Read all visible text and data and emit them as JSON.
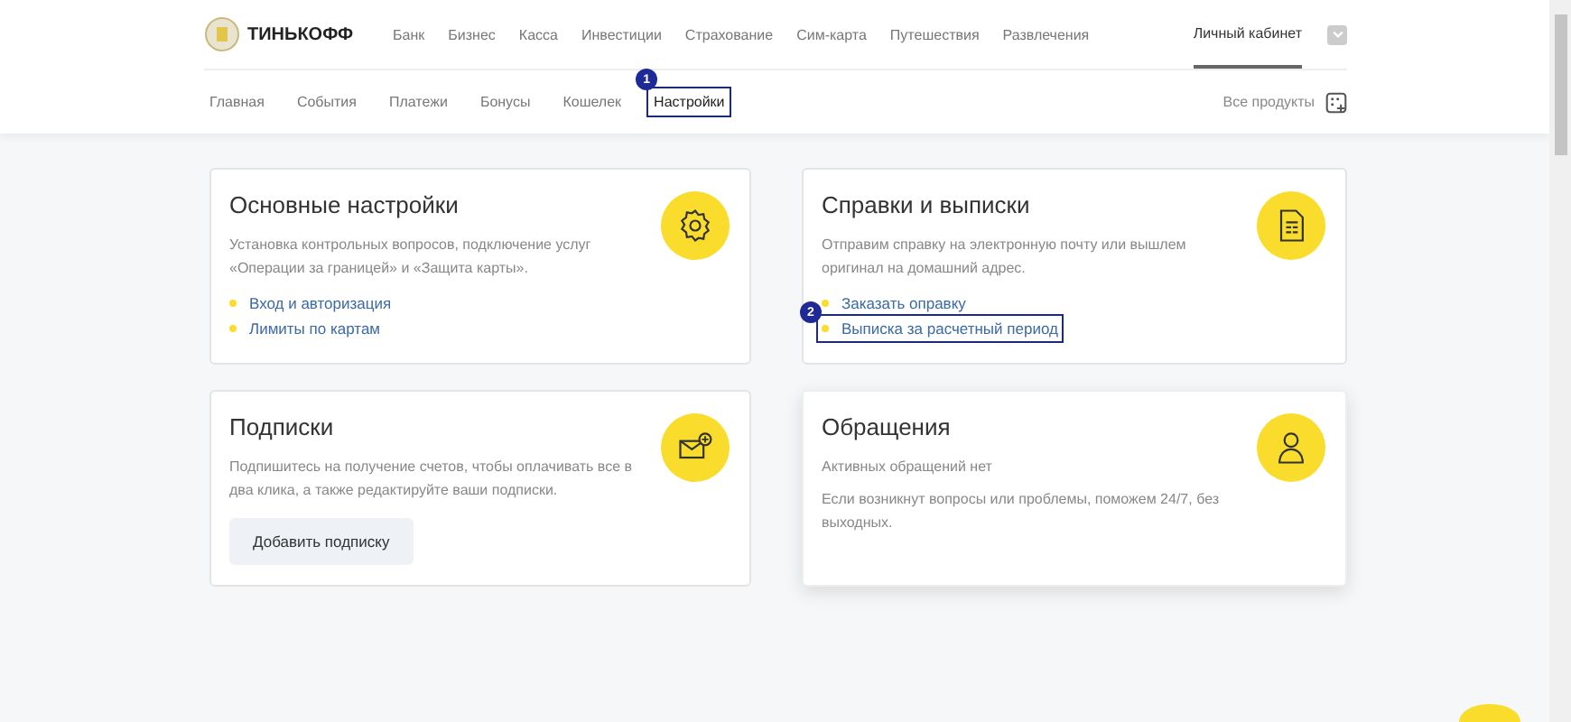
{
  "header": {
    "logo_text": "ТИНЬКОФФ",
    "main_nav": [
      {
        "label": "Банк",
        "selected": false
      },
      {
        "label": "Бизнес",
        "selected": false
      },
      {
        "label": "Касса",
        "selected": false
      },
      {
        "label": "Инвестиции",
        "selected": false
      },
      {
        "label": "Страхование",
        "selected": false
      },
      {
        "label": "Сим-карта",
        "selected": false
      },
      {
        "label": "Путешествия",
        "selected": false
      },
      {
        "label": "Развлечения",
        "selected": false
      }
    ],
    "account": {
      "label": "Личный кабинет",
      "selected": true
    },
    "sub_nav": [
      {
        "label": "Главная",
        "selected": false
      },
      {
        "label": "События",
        "selected": false
      },
      {
        "label": "Платежи",
        "selected": false
      },
      {
        "label": "Бонусы",
        "selected": false
      },
      {
        "label": "Кошелек",
        "selected": false
      },
      {
        "label": "Настройки",
        "selected": true,
        "marker": "1"
      }
    ],
    "all_products": "Все продукты"
  },
  "cards": [
    {
      "kind": "links",
      "title": "Основные настройки",
      "hovered": false,
      "texts": [
        "Установка контрольных вопросов, подключение услуг «Операции за границей» и «Защита карты»."
      ],
      "links": [
        {
          "label": "Вход и авторизация"
        },
        {
          "label": "Лимиты по картам"
        }
      ]
    },
    {
      "kind": "links",
      "title": "Справки и выписки",
      "hovered": false,
      "texts": [
        "Отправим справку на электронную почту или вышлем оригинал на домашний адрес."
      ],
      "links": [
        {
          "label": "Заказать оправку"
        },
        {
          "label": "Выписка за расчетный период",
          "marker": "2"
        }
      ]
    },
    {
      "kind": "button",
      "title": "Подписки",
      "hovered": false,
      "texts": [
        "Подпишитесь на получение счетов, чтобы оплачивать все в два клика, а также редактируйте ваши подписки."
      ],
      "button": "Добавить подписку"
    },
    {
      "kind": "text",
      "title": "Обращения",
      "hovered": true,
      "texts": [
        "Активных обращений нет",
        "Если возникнут вопросы или проблемы, поможем 24/7, без выходных."
      ]
    }
  ]
}
